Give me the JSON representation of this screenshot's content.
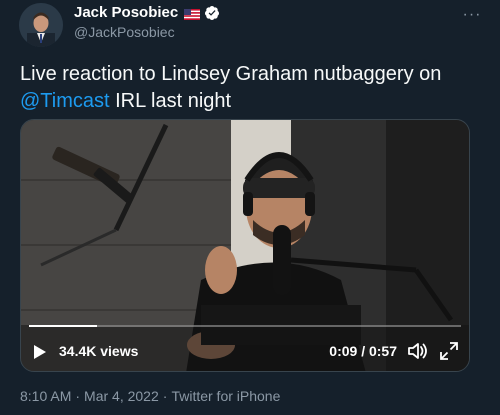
{
  "author": {
    "display_name": "Jack Posobiec",
    "handle": "@JackPosobiec",
    "flag_icon": "us-flag-icon",
    "verified_icon": "verified-badge-icon",
    "more_icon": "more-options-icon",
    "more_label": "···"
  },
  "tweet": {
    "text_before": "Live reaction to Lindsey Graham nutbaggery on ",
    "mention": "@Timcast",
    "text_after": " IRL last night"
  },
  "video": {
    "views": "34.4K views",
    "time": "0:09 / 0:57",
    "progress": 0.158,
    "play_icon": "play-icon",
    "volume_icon": "volume-icon",
    "fullscreen_icon": "fullscreen-icon"
  },
  "meta": {
    "time": "8:10 AM",
    "separator": "·",
    "date": "Mar 4, 2022",
    "source": "Twitter for iPhone"
  },
  "colors": {
    "background": "#15202b",
    "accent": "#1d9bf0",
    "secondary_text": "#8b98a5"
  }
}
